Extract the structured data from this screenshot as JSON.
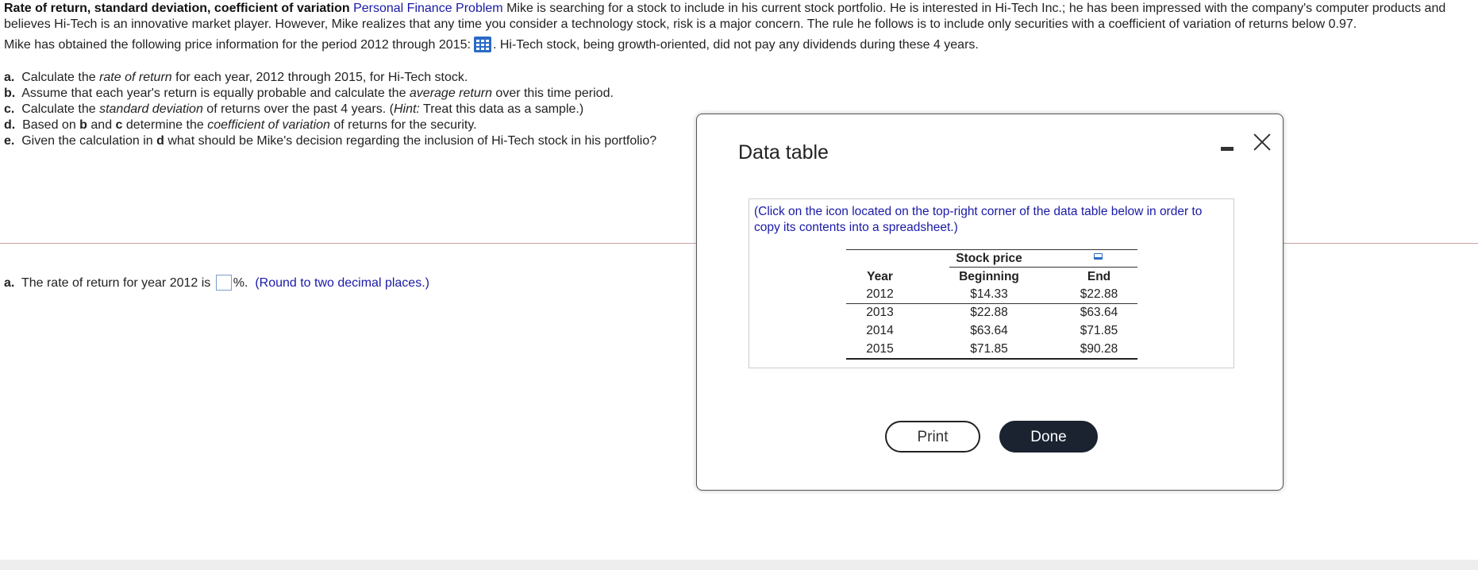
{
  "problem": {
    "title": "Rate of return, standard deviation, coefficient of variation",
    "category": "Personal Finance Problem",
    "intro": "Mike is searching for a stock to include in his current stock portfolio.  He is interested in Hi-Tech Inc.; he has been impressed with the company's computer products and believes Hi-Tech is an innovative market player.  However, Mike realizes that any time you consider a technology stock, risk is a major concern.  The rule he follows is to include only securities with a coefficient of variation of returns below 0.97.",
    "price_info_before": "Mike has obtained the following price information for the period 2012 through 2015:",
    "price_info_after": ".  Hi-Tech stock, being growth-oriented, did not pay any dividends during these 4 years.",
    "data_icon": "table-grid-icon"
  },
  "parts": {
    "a": {
      "label": "a.",
      "t1": "Calculate the ",
      "em1": "rate of return",
      "t2": " for each year, 2012 through 2015, for Hi-Tech stock."
    },
    "b": {
      "label": "b.",
      "t1": "Assume that each year's return is equally probable and calculate the ",
      "em1": "average return",
      "t2": " over this time period."
    },
    "c": {
      "label": "c.",
      "t1": "Calculate the ",
      "em1": "standard deviation",
      "t2": " of returns over the past 4 years.  (",
      "em2": "Hint:",
      "t3": " Treat this data as a sample.)"
    },
    "d": {
      "label": "d.",
      "t1": "Based on ",
      "b1": "b",
      "t2": " and ",
      "b2": "c",
      "t3": " determine the ",
      "em1": "coefficient of variation",
      "t4": " of returns for the security."
    },
    "e": {
      "label": "e.",
      "t1": "Given the calculation in ",
      "b1": "d",
      "t2": " what should be Mike's decision regarding the inclusion of Hi-Tech stock in his portfolio?"
    }
  },
  "answer": {
    "label": "a.",
    "text": "The rate of return for year 2012 is",
    "value": "",
    "unit": "%.",
    "hint": "(Round to two decimal places.)"
  },
  "dialog": {
    "title": "Data table",
    "note": "(Click on the icon located on the top-right corner of the data table below in order to copy its contents into a spreadsheet.)",
    "table": {
      "group_header": "Stock price",
      "headers": [
        "Year",
        "Beginning",
        "End"
      ],
      "rows": [
        [
          "2012",
          "$14.33",
          "$22.88"
        ],
        [
          "2013",
          "$22.88",
          "$63.64"
        ],
        [
          "2014",
          "$63.64",
          "$71.85"
        ],
        [
          "2015",
          "$71.85",
          "$90.28"
        ]
      ],
      "copy_icon": "copy-to-spreadsheet-icon"
    },
    "print_label": "Print",
    "done_label": "Done",
    "minimize_icon": "minimize-icon",
    "close_icon": "close-icon"
  },
  "colors": {
    "link_blue": "#1a1aa6",
    "icon_blue": "#2a6ac8",
    "done_bg": "#1b2331",
    "divider": "#c9a3a3"
  }
}
